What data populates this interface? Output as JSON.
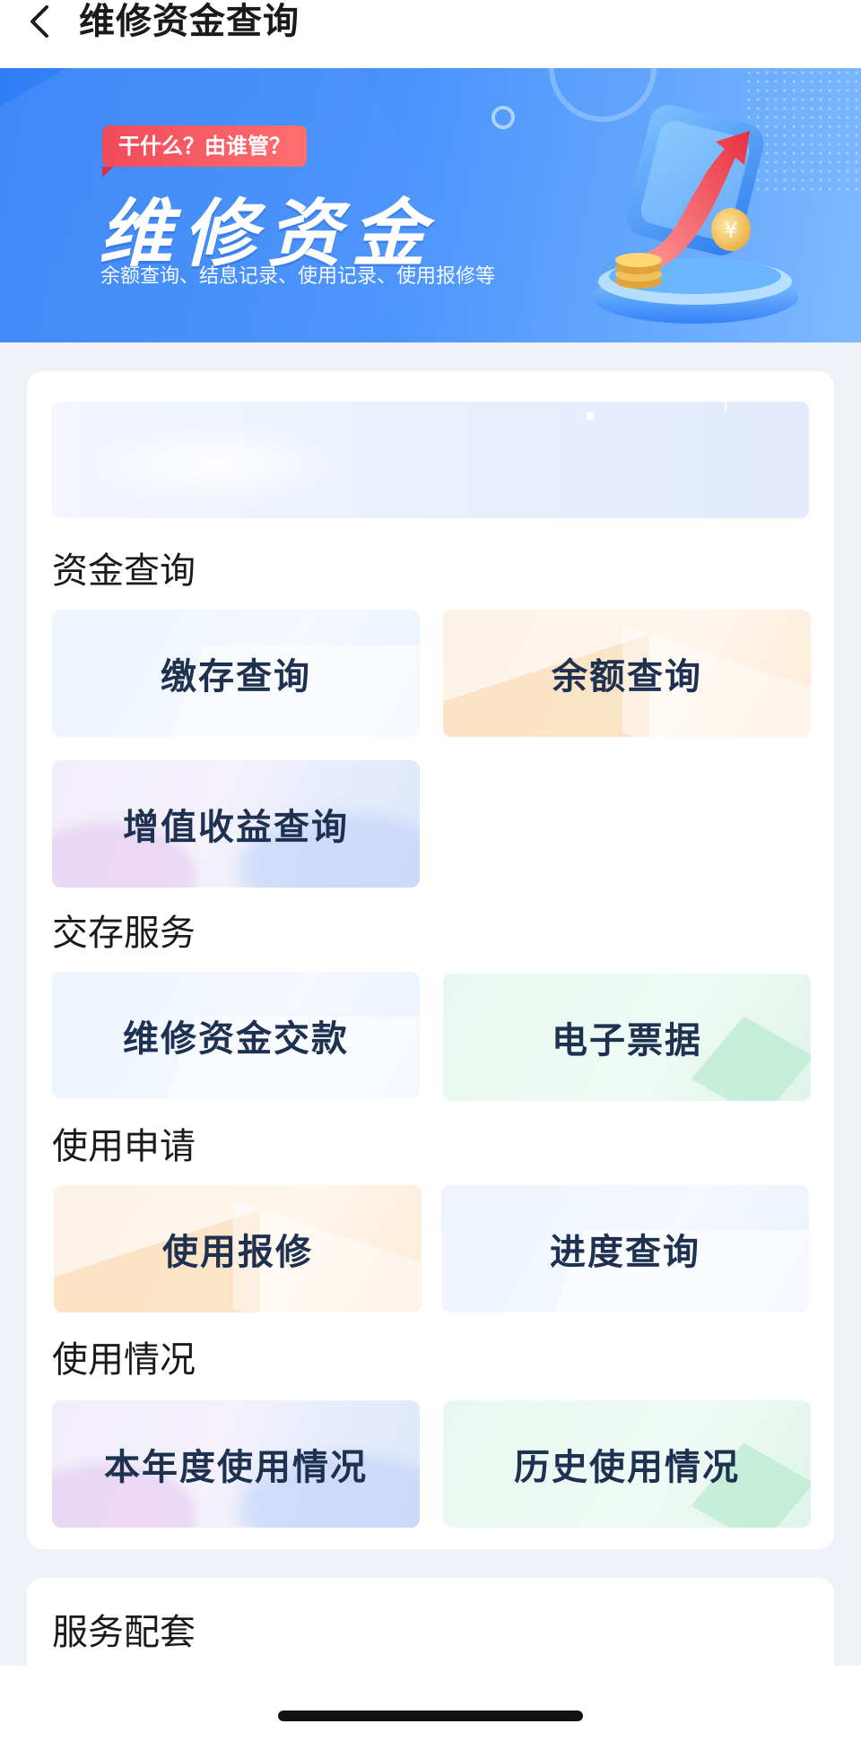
{
  "header": {
    "title": "维修资金查询",
    "back_icon": "chevron-left-icon"
  },
  "banner": {
    "tag": "干什么？由谁管？",
    "title": "维修资金",
    "subtitle": "余额查询、结息记录、使用记录、使用报修等",
    "illustration": "coin-growth-illustration",
    "colors": {
      "primary": "#2f7ef7",
      "tag": "#f04a5a"
    }
  },
  "sections": {
    "fund_query": {
      "title": "资金查询",
      "items": [
        "缴存查询",
        "余额查询",
        "增值收益查询"
      ]
    },
    "deposit_service": {
      "title": "交存服务",
      "items": [
        "维修资金交款",
        "电子票据"
      ]
    },
    "usage_apply": {
      "title": "使用申请",
      "items": [
        "使用报修",
        "进度查询"
      ]
    },
    "usage_status": {
      "title": "使用情况",
      "items": [
        "本年度使用情况",
        "历史使用情况"
      ]
    },
    "service": {
      "title": "服务配套"
    }
  }
}
